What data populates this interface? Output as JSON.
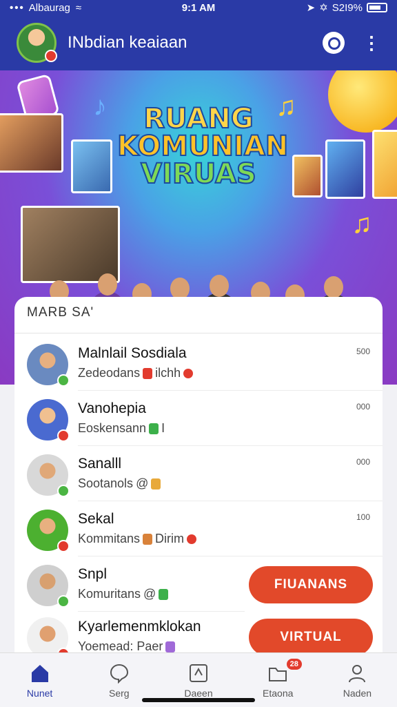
{
  "status": {
    "carrier": "Albaurag",
    "time": "9:1 AM",
    "battery": "S2I9%"
  },
  "header": {
    "title": "INbdian keaiaan"
  },
  "hero": {
    "line1": "RUANG",
    "line2": "KOMUNIAN",
    "line3": "VIRUAS"
  },
  "list": {
    "section_label": "MARB SA'",
    "rows": [
      {
        "name": "Malnlail Sosdiala",
        "sub": "Zedeodans",
        "sub2": "ilchh",
        "time": "500",
        "status_color": "#4bb543",
        "tag_color": "#e23b2e"
      },
      {
        "name": "Vanohepia",
        "sub": "Eoskensann",
        "sub2": "I",
        "time": "000",
        "status_color": "#e23b2e",
        "tag_color": "#3cb04a"
      },
      {
        "name": "Sanalll",
        "sub": "Sootanols",
        "sub2": "@",
        "time": "000",
        "status_color": "#4bb543",
        "tag_color": "#e8a93a"
      },
      {
        "name": "Sekal",
        "sub": "Kommitans",
        "sub2": "Dirim",
        "time": "100",
        "status_color": "#e23b2e",
        "tag_color": "#d9823a"
      },
      {
        "name": "Snpl",
        "sub": "Komuritans",
        "sub2": "@",
        "button": "FIUANANS",
        "status_color": "#4bb543",
        "tag_color": "#3cb04a"
      },
      {
        "name": "Kyarlemenmklokan",
        "sub": "Yoemead: Paer",
        "sub2": "",
        "button": "VIRTUAL",
        "status_color": "#e23b2e",
        "tag_color": "#a06ad8"
      }
    ]
  },
  "nav": {
    "items": [
      {
        "label": "Nunet",
        "icon": "home-icon"
      },
      {
        "label": "Serg",
        "icon": "chat-bubble-icon"
      },
      {
        "label": "Daeen",
        "icon": "share-box-icon"
      },
      {
        "label": "Etaona",
        "icon": "folder-icon",
        "badge": "28"
      },
      {
        "label": "Naden",
        "icon": "person-icon"
      }
    ]
  },
  "colors": {
    "brand": "#2a3aa6",
    "accent": "#e2492a"
  }
}
